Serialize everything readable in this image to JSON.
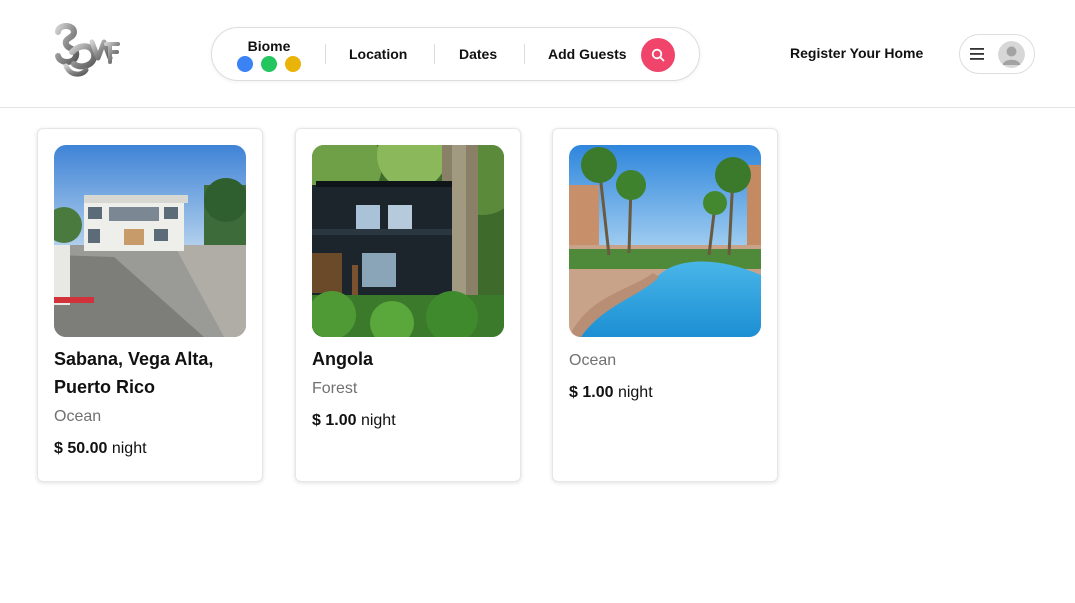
{
  "header": {
    "search": {
      "biome_label": "Biome",
      "biome_dots": [
        {
          "name": "blue",
          "color": "#3b82f6"
        },
        {
          "name": "green",
          "color": "#22c55e"
        },
        {
          "name": "yellow",
          "color": "#eab308"
        }
      ],
      "location_label": "Location",
      "dates_label": "Dates",
      "guests_label": "Add Guests",
      "search_icon": "search-icon",
      "accent_color": "#f0446a"
    },
    "register_label": "Register Your Home",
    "menu_icon": "hamburger-icon",
    "avatar_icon": "user-avatar-icon"
  },
  "listings": [
    {
      "title": "Sabana, Vega Alta, Puerto Rico",
      "biome": "Ocean",
      "price": "$ 50.00",
      "unit": "night",
      "image": "white-house-on-paved-lot"
    },
    {
      "title": "Angola",
      "biome": "Forest",
      "price": "$ 1.00",
      "unit": "night",
      "image": "dark-cabin-in-forest"
    },
    {
      "title": "",
      "biome": "Ocean",
      "price": "$ 1.00",
      "unit": "night",
      "image": "resort-pool-with-palms"
    }
  ]
}
